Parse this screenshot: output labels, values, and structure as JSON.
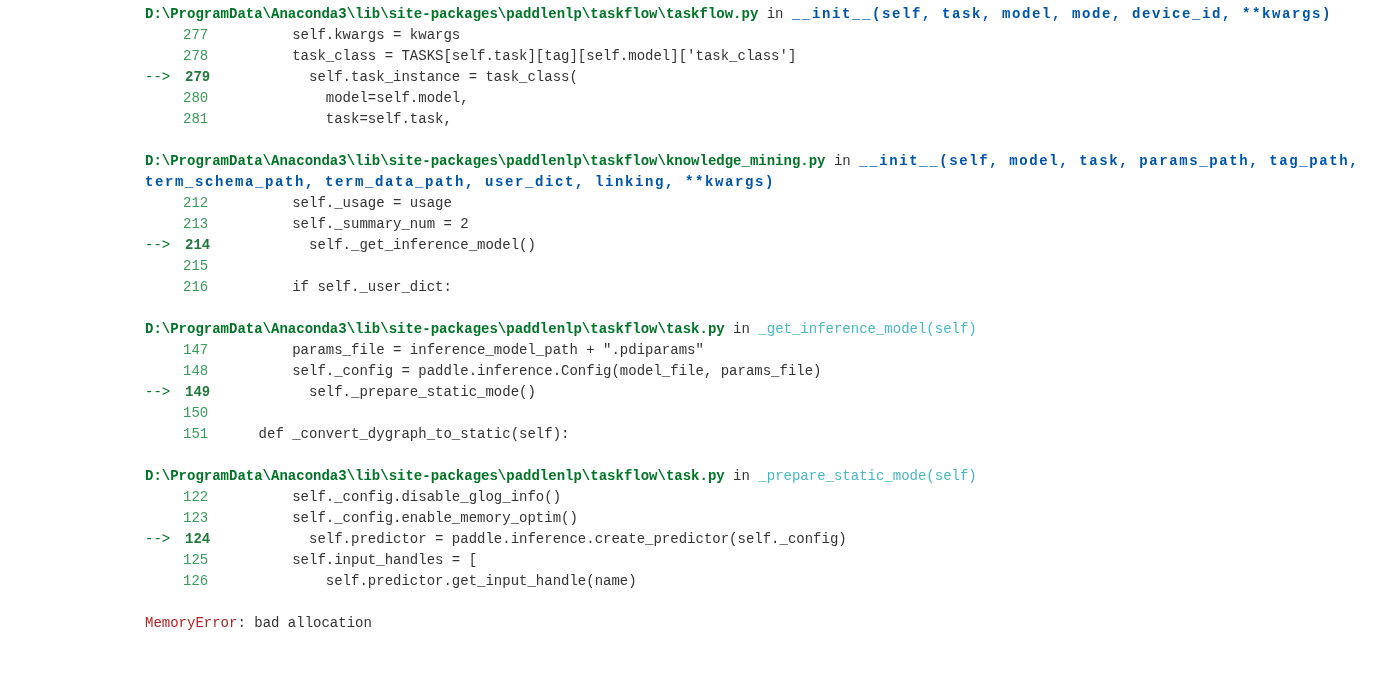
{
  "frames": [
    {
      "path": "D:\\ProgramData\\Anaconda3\\lib\\site-packages\\paddlenlp\\taskflow\\taskflow.py",
      "in": "in",
      "call": "__init__(self, task, model, mode, device_id, **kwargs)",
      "kind": "bold",
      "lines": [
        {
          "number": "277",
          "current": false,
          "code": "        self.kwargs = kwargs"
        },
        {
          "number": "278",
          "current": false,
          "code": "        task_class = TASKS[self.task][tag][self.model]['task_class']"
        },
        {
          "number": "279",
          "current": true,
          "marker": "-->",
          "code": "          self.task_instance = task_class("
        },
        {
          "number": "280",
          "current": false,
          "code": "            model=self.model,"
        },
        {
          "number": "281",
          "current": false,
          "code": "            task=self.task,"
        }
      ]
    },
    {
      "path": "D:\\ProgramData\\Anaconda3\\lib\\site-packages\\paddlenlp\\taskflow\\knowledge_mining.py",
      "in": "in",
      "call": "__init__(self, model, task, params_path, tag_path, term_schema_path, term_data_path, user_dict, linking, **kwargs)",
      "kind": "bold",
      "lines": [
        {
          "number": "212",
          "current": false,
          "code": "        self._usage = usage"
        },
        {
          "number": "213",
          "current": false,
          "code": "        self._summary_num = 2"
        },
        {
          "number": "214",
          "current": true,
          "marker": "-->",
          "code": "          self._get_inference_model()"
        },
        {
          "number": "215",
          "current": false
        },
        {
          "number": "216",
          "current": false,
          "code": "        if self._user_dict:"
        }
      ]
    },
    {
      "path": "D:\\ProgramData\\Anaconda3\\lib\\site-packages\\paddlenlp\\taskflow\\task.py",
      "in": "in",
      "call": "_get_inference_model(self)",
      "kind": "plain",
      "lines": [
        {
          "number": "147",
          "current": false,
          "code": "        params_file = inference_model_path + \".pdiparams\""
        },
        {
          "number": "148",
          "current": false,
          "code": "        self._config = paddle.inference.Config(model_file, params_file)"
        },
        {
          "number": "149",
          "current": true,
          "marker": "-->",
          "code": "          self._prepare_static_mode()"
        },
        {
          "number": "150",
          "current": false
        },
        {
          "number": "151",
          "current": false,
          "code": "    def _convert_dygraph_to_static(self):"
        }
      ]
    },
    {
      "path": "D:\\ProgramData\\Anaconda3\\lib\\site-packages\\paddlenlp\\taskflow\\task.py",
      "in": "in",
      "call": "_prepare_static_mode(self)",
      "kind": "plain",
      "lines": [
        {
          "number": "122",
          "current": false,
          "code": "        self._config.disable_glog_info()"
        },
        {
          "number": "123",
          "current": false,
          "code": "        self._config.enable_memory_optim()"
        },
        {
          "number": "124",
          "current": true,
          "marker": "-->",
          "code": "          self.predictor = paddle.inference.create_predictor(self._config)"
        },
        {
          "number": "125",
          "current": false,
          "code": "        self.input_handles = ["
        },
        {
          "number": "126",
          "current": false,
          "code": "            self.predictor.get_input_handle(name)"
        }
      ]
    }
  ],
  "error": {
    "type": "MemoryError",
    "message": ": bad allocation"
  }
}
